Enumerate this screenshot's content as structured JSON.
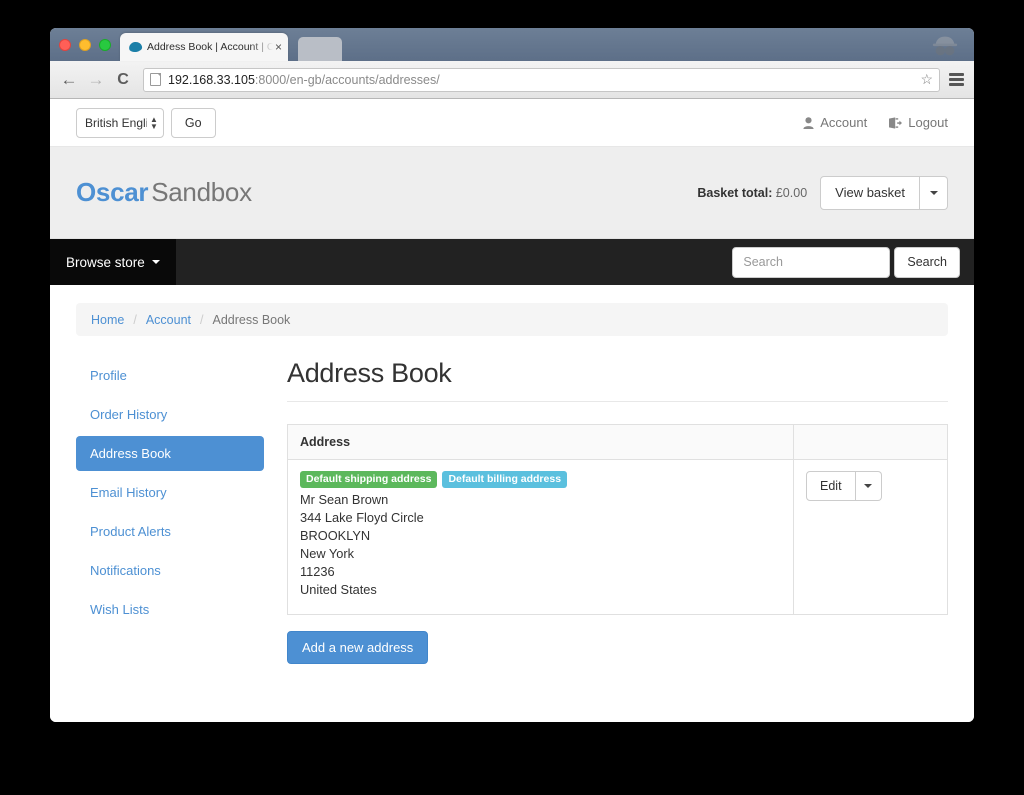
{
  "browser": {
    "tab_title": "Address Book | Account | O",
    "tab_close": "×",
    "back_icon": "←",
    "forward_icon": "→",
    "reload_icon": "C",
    "url_host": "192.168.33.105",
    "url_rest": ":8000/en-gb/accounts/addresses/",
    "star_icon": "☆"
  },
  "topstrip": {
    "language_value": "British English",
    "go_label": "Go",
    "account_label": "Account",
    "logout_label": "Logout"
  },
  "header": {
    "brand_name": "Oscar",
    "brand_suffix": "Sandbox",
    "basket_label": "Basket total:",
    "basket_value": "£0.00",
    "view_basket_label": "View basket"
  },
  "navbar": {
    "browse_store_label": "Browse store",
    "search_placeholder": "Search",
    "search_value": "",
    "search_button_label": "Search"
  },
  "breadcrumb": {
    "home": "Home",
    "account": "Account",
    "current": "Address Book",
    "separator": "/"
  },
  "sidebar": {
    "items": [
      {
        "label": "Profile",
        "active": false
      },
      {
        "label": "Order History",
        "active": false
      },
      {
        "label": "Address Book",
        "active": true
      },
      {
        "label": "Email History",
        "active": false
      },
      {
        "label": "Product Alerts",
        "active": false
      },
      {
        "label": "Notifications",
        "active": false
      },
      {
        "label": "Wish Lists",
        "active": false
      }
    ]
  },
  "main": {
    "page_title": "Address Book",
    "table": {
      "columns": [
        "Address",
        ""
      ],
      "rows": [
        {
          "badges": [
            "Default shipping address",
            "Default billing address"
          ],
          "lines": [
            "Mr Sean Brown",
            "344 Lake Floyd Circle",
            "BROOKLYN",
            "New York",
            "11236",
            "United States"
          ],
          "edit_label": "Edit"
        }
      ]
    },
    "add_address_label": "Add a new address"
  },
  "colors": {
    "brand_blue": "#4d90d3",
    "badge_green": "#5cb85c",
    "badge_blue": "#5bc0de",
    "navbar_dark": "#222222",
    "header_gray": "#eeeeee"
  }
}
